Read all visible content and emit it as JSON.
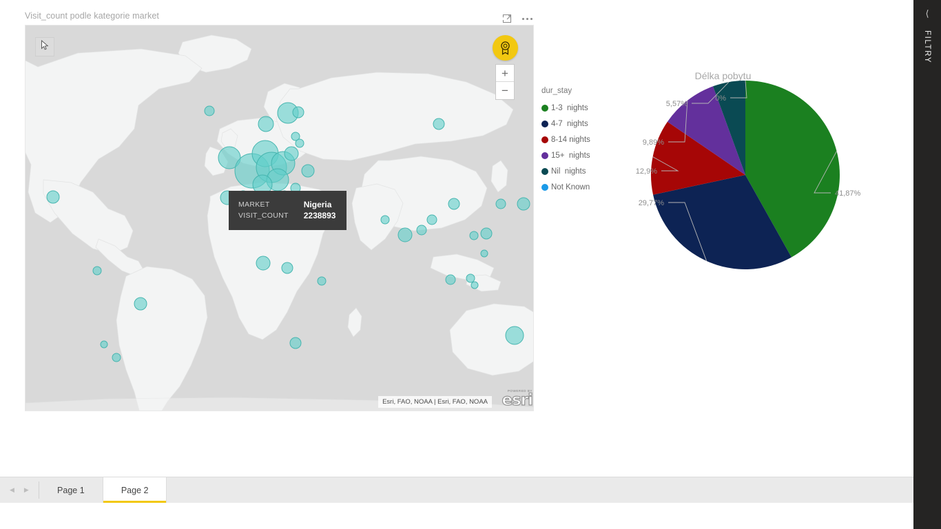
{
  "visual_header": {
    "title": "Visit_count podle kategorie market",
    "focus_icon": "focus-mode-icon",
    "more_options_icon": "more-options-icon"
  },
  "map": {
    "select_tool_icon": "cursor-select-icon",
    "badge_icon": "award-badge-icon",
    "zoom_in_label": "+",
    "zoom_out_label": "−",
    "attribution": "Esri, FAO, NOAA | Esri, FAO, NOAA",
    "logo_powered_by": "POWERED BY",
    "logo_word": "esri",
    "tooltip": {
      "rows": [
        {
          "key": "MARKET",
          "value": "Nigeria"
        },
        {
          "key": "VISIT_COUNT",
          "value": "2238893"
        }
      ]
    },
    "bubble_color": "#63cfc9",
    "land_color": "#f3f4f4",
    "ocean_color": "#d9d9d9"
  },
  "chart_data": {
    "type": "pie",
    "title": "Délka pobytu",
    "legend_title": "dur_stay",
    "legend_position": "left",
    "categories": [
      "1-3  nights",
      "4-7  nights",
      "8-14 nights",
      "15+  nights",
      "Nil  nights",
      "Not Known"
    ],
    "values": [
      41.87,
      29.77,
      12.9,
      9.89,
      5.57,
      0
    ],
    "labels": [
      "41,87%",
      "29,77%",
      "12,9%",
      "9,89%",
      "5,57%",
      "0%"
    ],
    "colors": [
      "#1b8020",
      "#0d2354",
      "#a60606",
      "#63309c",
      "#0a4a53",
      "#1b9ae8"
    ],
    "start_angle_deg": 0,
    "direction": "clockwise"
  },
  "tabbar": {
    "prev_icon": "chevron-left-icon",
    "next_icon": "chevron-right-icon",
    "tabs": [
      {
        "label": "Page 1",
        "active": false
      },
      {
        "label": "Page 2",
        "active": true
      }
    ],
    "active_underline_color": "#f2c811"
  },
  "filters_rail": {
    "collapse_icon": "chevron-left-icon",
    "label": "FILTRY",
    "background": "#252423"
  }
}
